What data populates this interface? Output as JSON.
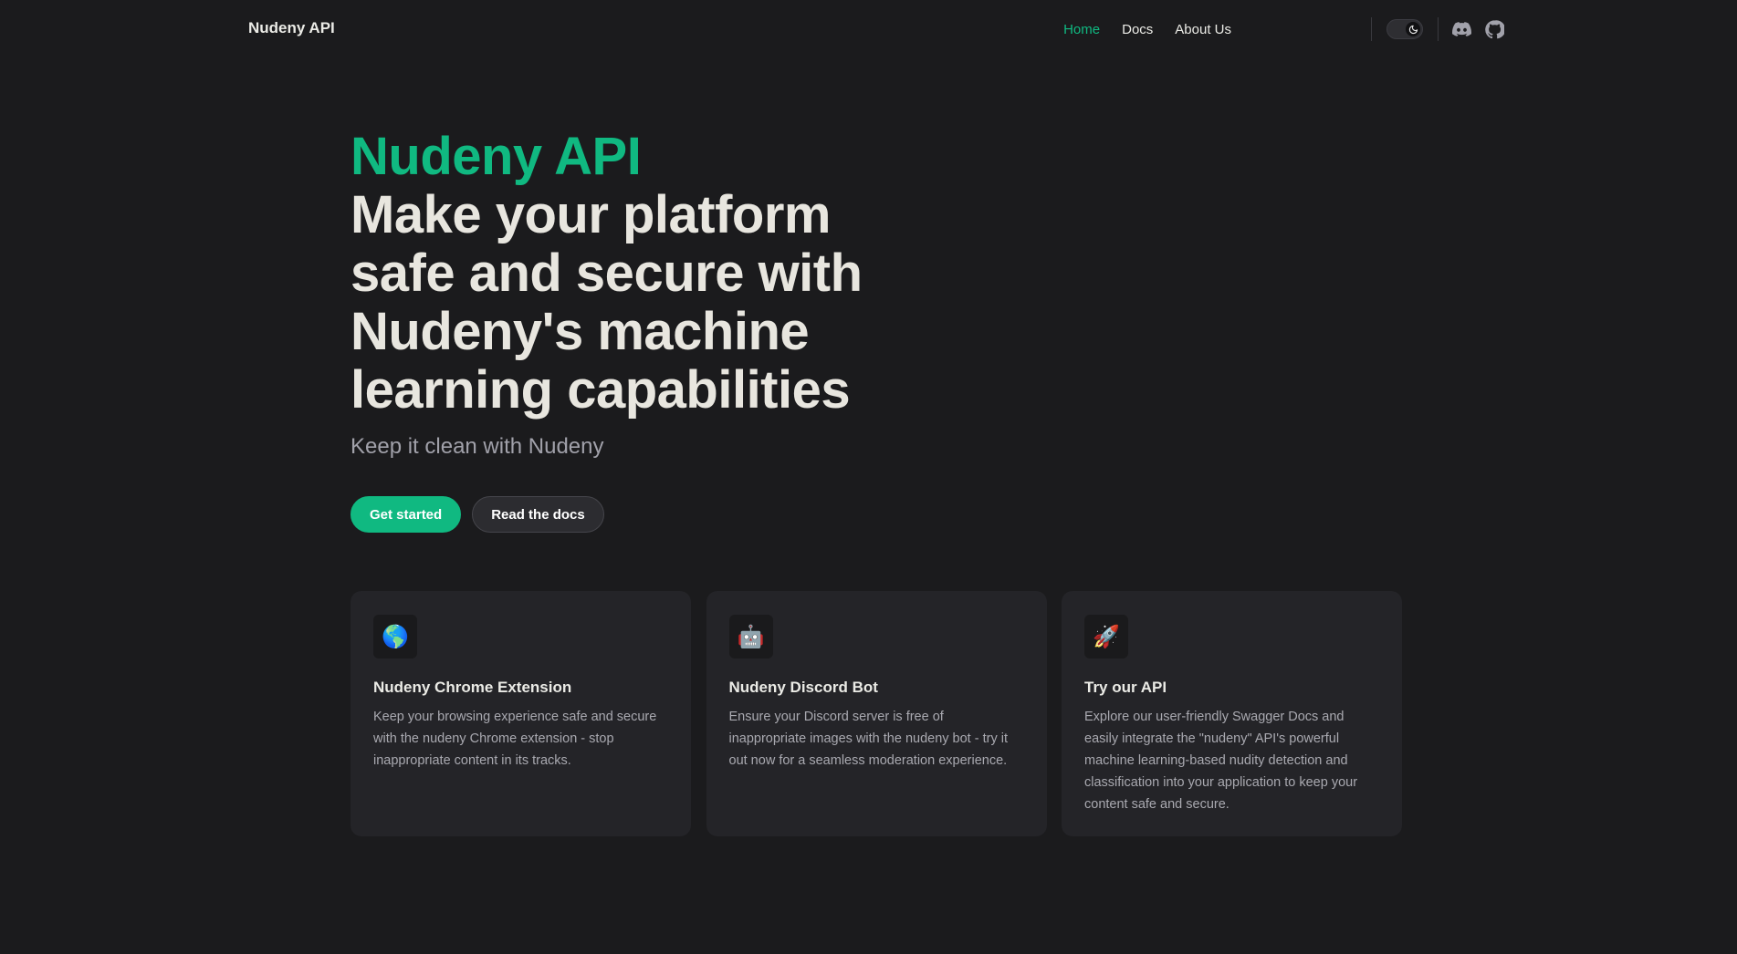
{
  "nav": {
    "brand": "Nudeny API",
    "links": [
      {
        "label": "Home",
        "active": true
      },
      {
        "label": "Docs",
        "active": false
      },
      {
        "label": "About Us",
        "active": false
      }
    ],
    "theme_toggle": "dark-mode",
    "social_icons": [
      "discord-icon",
      "github-icon"
    ]
  },
  "hero": {
    "title_accent": "Nudeny API",
    "title_main": "Make your platform safe and secure with Nudeny's machine learning capabilities",
    "subtitle": "Keep it clean with Nudeny",
    "primary_button": "Get started",
    "secondary_button": "Read the docs"
  },
  "cards": [
    {
      "icon": "🌎",
      "title": "Nudeny Chrome Extension",
      "description": "Keep your browsing experience safe and secure with the nudeny Chrome extension - stop inappropriate content in its tracks."
    },
    {
      "icon": "🤖",
      "title": "Nudeny Discord Bot",
      "description": "Ensure your Discord server is free of inappropriate images with the nudeny bot - try it out now for a seamless moderation experience."
    },
    {
      "icon": "🚀",
      "title": "Try our API",
      "description": "Explore our user-friendly Swagger Docs and easily integrate the \"nudeny\" API's powerful machine learning-based nudity detection and classification into your application to keep your content safe and secure."
    }
  ],
  "colors": {
    "accent": "#10b981",
    "background": "#1b1b1d",
    "card": "#242428"
  }
}
